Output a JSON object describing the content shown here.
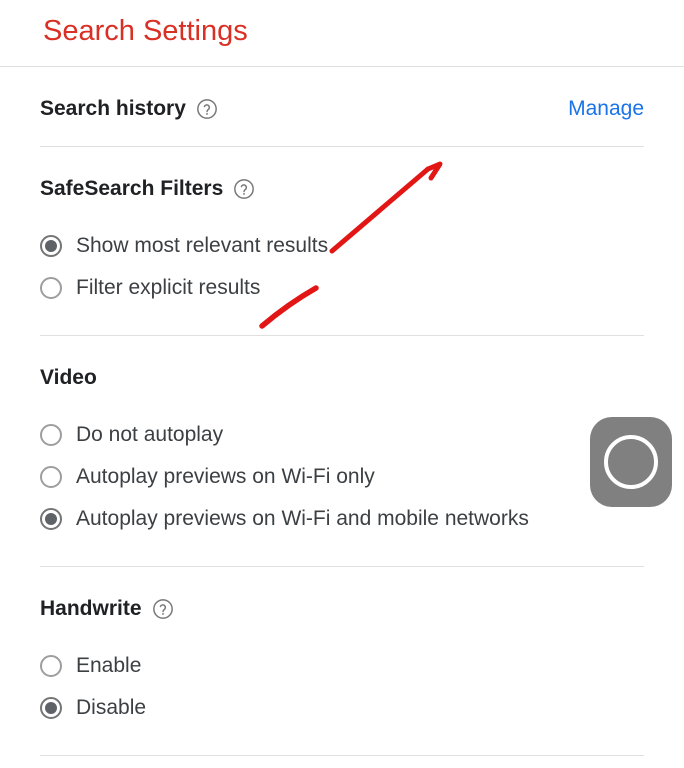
{
  "title": "Search Settings",
  "sections": {
    "history": {
      "heading": "Search history",
      "manage": "Manage",
      "helpIcon": "help-icon"
    },
    "safesearch": {
      "heading": "SafeSearch Filters",
      "helpIcon": "help-icon",
      "options": [
        {
          "label": "Show most relevant results",
          "selected": true
        },
        {
          "label": "Filter explicit results",
          "selected": false
        }
      ]
    },
    "video": {
      "heading": "Video",
      "options": [
        {
          "label": "Do not autoplay",
          "selected": false
        },
        {
          "label": "Autoplay previews on Wi-Fi only",
          "selected": false
        },
        {
          "label": "Autoplay previews on Wi-Fi and mobile networks",
          "selected": true
        }
      ]
    },
    "handwrite": {
      "heading": "Handwrite",
      "helpIcon": "help-icon",
      "options": [
        {
          "label": "Enable",
          "selected": false
        },
        {
          "label": "Disable",
          "selected": true
        }
      ]
    }
  },
  "floatButton": {
    "icon": "circle-icon"
  }
}
